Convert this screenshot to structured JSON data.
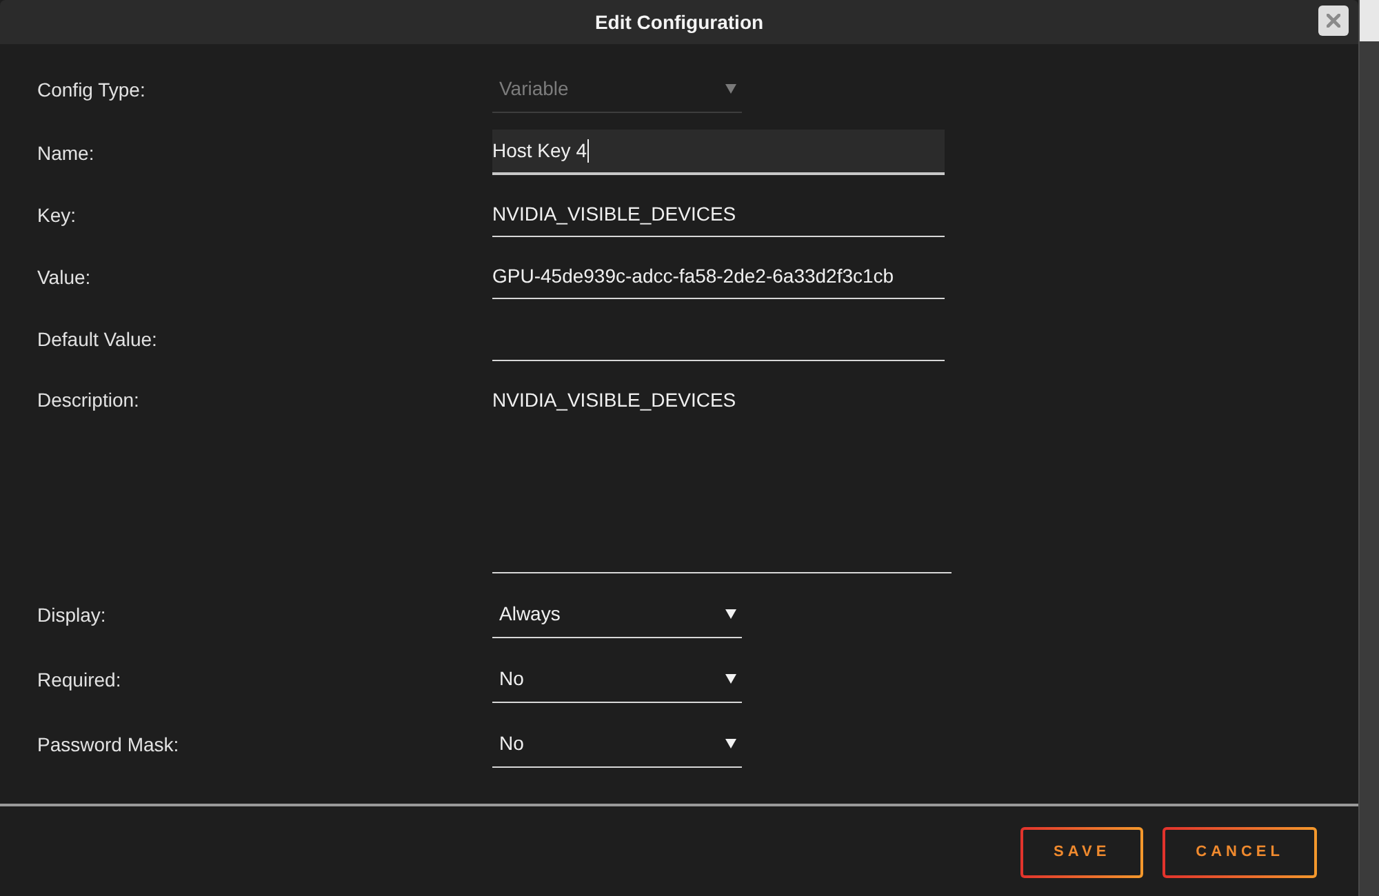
{
  "dialog": {
    "title": "Edit Configuration"
  },
  "fields": [
    {
      "label": "Config Type:",
      "kind": "select",
      "value": "Variable",
      "disabled": true,
      "focused": false
    },
    {
      "label": "Name:",
      "kind": "text",
      "value": "Host Key 4",
      "disabled": false,
      "focused": true
    },
    {
      "label": "Key:",
      "kind": "text",
      "value": "NVIDIA_VISIBLE_DEVICES",
      "disabled": false,
      "focused": false
    },
    {
      "label": "Value:",
      "kind": "text",
      "value": "GPU-45de939c-adcc-fa58-2de2-6a33d2f3c1cb",
      "disabled": false,
      "focused": false
    },
    {
      "label": "Default Value:",
      "kind": "text",
      "disabled": false,
      "focused": false
    },
    {
      "label": "Description:",
      "kind": "textarea",
      "value": "NVIDIA_VISIBLE_DEVICES",
      "disabled": false,
      "focused": false
    },
    {
      "label": "Display:",
      "kind": "select",
      "value": "Always",
      "disabled": false,
      "focused": false
    },
    {
      "label": "Required:",
      "kind": "select",
      "value": "No",
      "disabled": false,
      "focused": false
    },
    {
      "label": "Password Mask:",
      "kind": "select",
      "value": "No",
      "disabled": false,
      "focused": false
    }
  ],
  "buttons": [
    {
      "label": "SAVE"
    },
    {
      "label": "CANCEL"
    }
  ]
}
